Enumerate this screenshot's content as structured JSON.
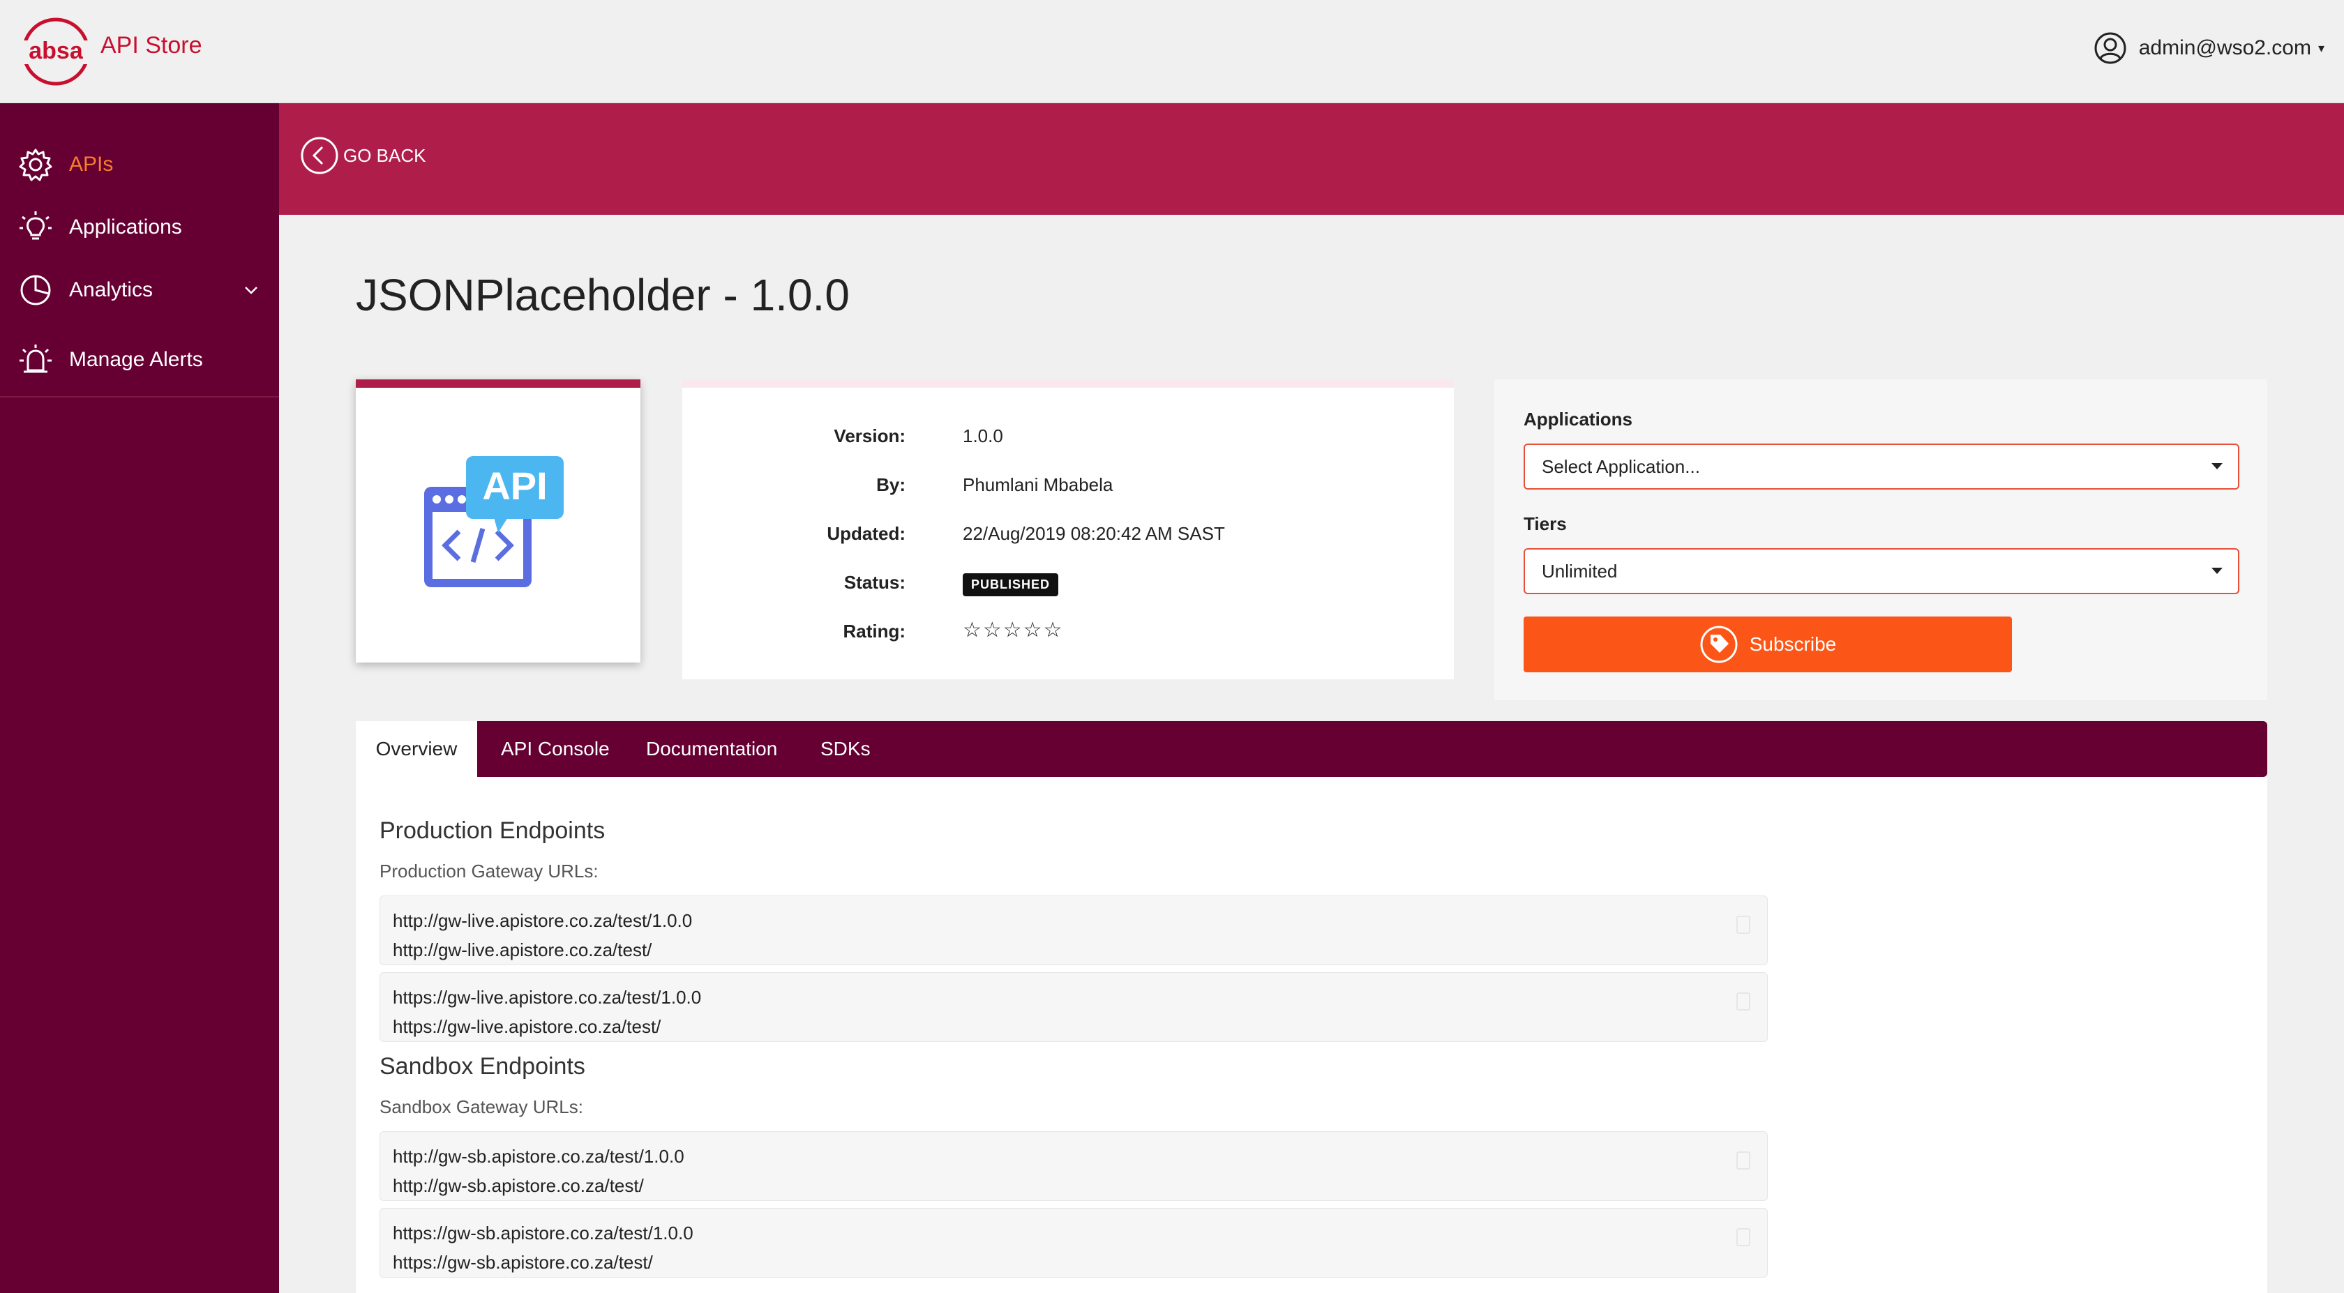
{
  "header": {
    "store_name": "API Store",
    "user": "admin@wso2.com",
    "logo_text": "absa"
  },
  "sidebar": {
    "items": [
      {
        "label": "APIs",
        "icon": "gear-icon",
        "active": true
      },
      {
        "label": "Applications",
        "icon": "lightbulb-icon",
        "active": false
      },
      {
        "label": "Analytics",
        "icon": "pie-chart-icon",
        "active": false,
        "has_submenu": true
      },
      {
        "label": "Manage Alerts",
        "icon": "alarm-icon",
        "active": false
      }
    ]
  },
  "banner": {
    "go_back_label": "GO BACK"
  },
  "api": {
    "title": "JSONPlaceholder - 1.0.0",
    "thumbnail_text": "API",
    "info": {
      "version_label": "Version:",
      "version": "1.0.0",
      "by_label": "By:",
      "by": "Phumlani Mbabela",
      "updated_label": "Updated:",
      "updated": "22/Aug/2019 08:20:42 AM SAST",
      "status_label": "Status:",
      "status": "PUBLISHED",
      "rating_label": "Rating:",
      "rating_stars": "☆☆☆☆☆",
      "rating_value": 0
    }
  },
  "subscribe": {
    "applications_label": "Applications",
    "applications_selected": "Select Application...",
    "tiers_label": "Tiers",
    "tiers_selected": "Unlimited",
    "button_label": "Subscribe"
  },
  "tabs": [
    {
      "label": "Overview",
      "active": true
    },
    {
      "label": "API Console",
      "active": false
    },
    {
      "label": "Documentation",
      "active": false
    },
    {
      "label": "SDKs",
      "active": false
    }
  ],
  "overview": {
    "production": {
      "title": "Production Endpoints",
      "subtitle": "Production Gateway URLs:",
      "groups": [
        [
          "http://gw-live.apistore.co.za/test/1.0.0",
          "http://gw-live.apistore.co.za/test/"
        ],
        [
          "https://gw-live.apistore.co.za/test/1.0.0",
          "https://gw-live.apistore.co.za/test/"
        ]
      ]
    },
    "sandbox": {
      "title": "Sandbox Endpoints",
      "subtitle": "Sandbox Gateway URLs:",
      "groups": [
        [
          "http://gw-sb.apistore.co.za/test/1.0.0",
          "http://gw-sb.apistore.co.za/test/"
        ],
        [
          "https://gw-sb.apistore.co.za/test/1.0.0",
          "https://gw-sb.apistore.co.za/test/"
        ]
      ]
    }
  },
  "colors": {
    "sidebar": "#660033",
    "banner": "#af1e4a",
    "accent_orange": "#fb5617",
    "active_nav": "#f97d2c",
    "brand_red": "#c8102e"
  }
}
